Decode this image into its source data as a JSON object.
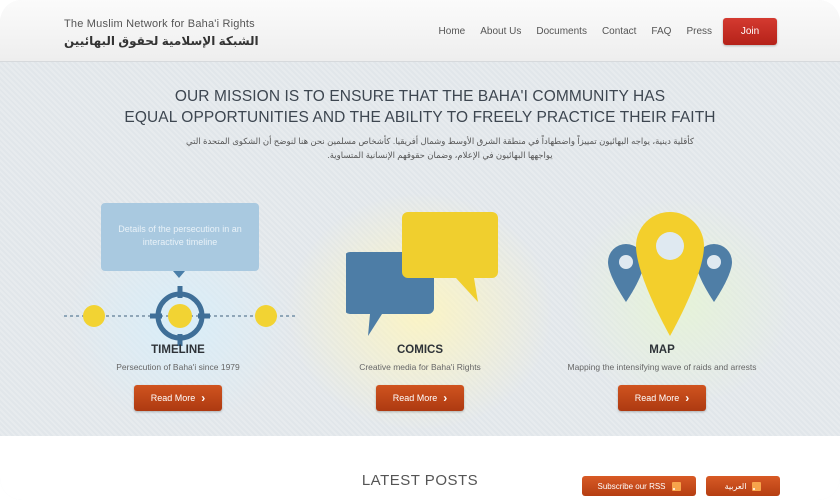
{
  "header": {
    "logo_en": "The Muslim Network for Baha'i Rights",
    "logo_ar": "الشبكة الإسلامية لحقوق البهائيين",
    "nav": [
      "Home",
      "About Us",
      "Documents",
      "Contact",
      "FAQ",
      "Press"
    ],
    "join_label": "Join"
  },
  "hero": {
    "mission_line1": "OUR MISSION IS TO ENSURE THAT THE BAHA'I COMMUNITY HAS",
    "mission_line2": "EQUAL OPPORTUNITIES AND THE ABILITY TO FREELY PRACTICE THEIR FAITH",
    "mission_ar_line1": "كأقلية دينية، يواجه البهائيون تمييزاً واضطهاداً في منطقة الشرق الأوسط وشمال أفريقيا. كأشخاص مسلمين نحن هنا لنوضح أن الشكوى المتحدة التي",
    "mission_ar_line2": "يواجهها البهائيون في الإعلام، وضمان حقوقهم الإنسانية المتساوية."
  },
  "features": [
    {
      "title": "TIMELINE",
      "desc": "Persecution of Baha'i since 1979",
      "button": "Read More",
      "tooltip": "Details of the persecution in an interactive timeline"
    },
    {
      "title": "COMICS",
      "desc": "Creative media for Baha'i Rights",
      "button": "Read More"
    },
    {
      "title": "MAP",
      "desc": "Mapping the intensifying wave of raids and arrests",
      "button": "Read More"
    }
  ],
  "latest": {
    "title": "LATEST POSTS",
    "subscribe_label": "Subscribe our RSS",
    "arabic_label": "العربية"
  },
  "colors": {
    "join_red": "#c42c22",
    "read_more_orange": "#c04a18",
    "timeline_yellow": "#f2d333",
    "timeline_blue": "#3f6f98",
    "comic_blue": "#4d7da6",
    "comic_yellow": "#f0cf2e",
    "pin_yellow": "#f3cf2c",
    "pin_blue": "#4f7ea6"
  },
  "icons": {
    "timeline": "target-crosshair-icon",
    "comics": "speech-bubbles-icon",
    "map": "map-pins-icon",
    "read_more_arrow": "chevron-right-icon",
    "rss": "rss-icon"
  }
}
